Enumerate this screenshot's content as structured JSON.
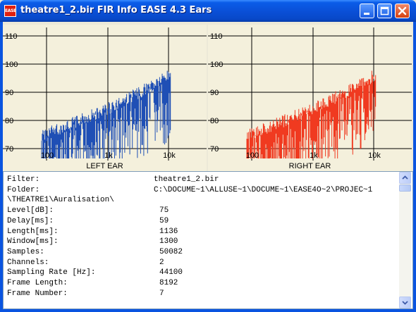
{
  "window": {
    "title": "theatre1_2.bir FIR Info EASE 4.3 Ears",
    "icon_text": "EASE"
  },
  "plots": {
    "left": {
      "label": "LEFT EAR",
      "color": "#1f4fb5",
      "y_ticks": [
        "110",
        "100",
        "90",
        "80",
        "70"
      ],
      "x_ticks": [
        "100",
        "1k",
        "10k"
      ]
    },
    "right": {
      "label": "RIGHT EAR",
      "color": "#f03a20",
      "y_ticks": [
        "110",
        "100",
        "90",
        "80",
        "70"
      ],
      "x_ticks": [
        "100",
        "1k",
        "10k"
      ]
    }
  },
  "info": {
    "rows": [
      {
        "key": "Filter:",
        "value": "theatre1_2.bir"
      },
      {
        "key": "Folder:",
        "value": "C:\\DOCUME~1\\ALLUSE~1\\DOCUME~1\\EASE4O~2\\PROJEC~1"
      },
      {
        "key": "\\THEATRE1\\Auralisation\\",
        "value": ""
      },
      {
        "key": "Level[dB]:",
        "value": "75"
      },
      {
        "key": "Delay[ms]:",
        "value": "59"
      },
      {
        "key": "Length[ms]:",
        "value": "1136"
      },
      {
        "key": "Window[ms]:",
        "value": "1300"
      },
      {
        "key": "Samples:",
        "value": "50082"
      },
      {
        "key": "Channels:",
        "value": "2"
      },
      {
        "key": "Sampling Rate [Hz]:",
        "value": "44100"
      },
      {
        "key": "Frame Length:",
        "value": "8192"
      },
      {
        "key": "Frame Number:",
        "value": "7"
      }
    ]
  }
}
